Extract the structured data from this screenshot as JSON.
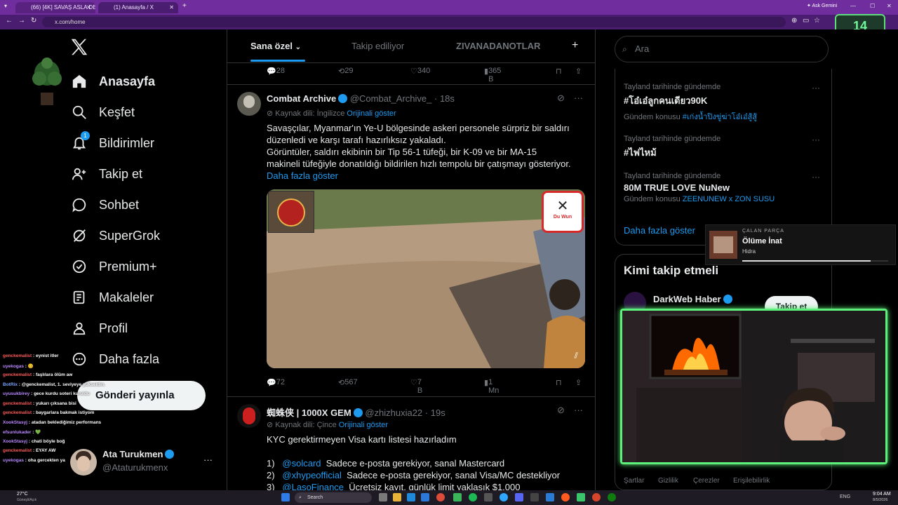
{
  "browser": {
    "tabs": [
      "(66) [4K] SAVAŞ ASLA DEĞİŞMEZ",
      "(1) Anasayfa / X"
    ],
    "url": "x.com/home",
    "ask_gemini": "Ask Gemini"
  },
  "overlay": {
    "timer": "14",
    "now_playing_label": "ÇALAN PARÇA",
    "now_playing_title": "Ölüme İnat",
    "now_playing_artist": "Hidra",
    "now_playing_progress": 0.88
  },
  "nav": {
    "items": [
      "Anasayfa",
      "Keşfet",
      "Bildirimler",
      "Takip et",
      "Sohbet",
      "SuperGrok",
      "Premium+",
      "Makaleler",
      "Profil",
      "Daha fazla"
    ],
    "notif_badge": "1",
    "post_button": "Gönderi yayınla",
    "account_name": "Ata Turukmen",
    "account_handle": "@Ataturukmenx",
    "account_more": "···"
  },
  "chat": [
    {
      "user": "genckemalist",
      "msg": "eynist itler",
      "color": "#ff5a5a"
    },
    {
      "user": "uyekogas",
      "msg": "😊",
      "color": "#bb88ff"
    },
    {
      "user": "genckemalist",
      "msg": "faşlılara ölüm aw",
      "color": "#ff5a5a"
    },
    {
      "user": "BotRix",
      "msg": "@genckemalist, 1. seviyeye yükseldin.",
      "color": "#7aa6ff"
    },
    {
      "user": "uyusukbirey",
      "msg": "gece kurdu soteri kuruldu",
      "color": "#bb88ff"
    },
    {
      "user": "genckemalist",
      "msg": "yukarı çıksana bisi",
      "color": "#ff5a5a"
    },
    {
      "user": "genckemalist",
      "msg": "baygarlara bakmak istiyom",
      "color": "#ff5a5a"
    },
    {
      "user": "XookStasyj",
      "msg": "atadan beklediğimiz performans",
      "color": "#bb88ff"
    },
    {
      "user": "efsunlukader",
      "msg": "💚",
      "color": "#bb88ff"
    },
    {
      "user": "XookStasyj",
      "msg": "chati böyle boğ",
      "color": "#bb88ff"
    },
    {
      "user": "genckemalist",
      "msg": "EYAY AW",
      "color": "#ff5a5a"
    },
    {
      "user": "uyekogas",
      "msg": "oha gercekten ya",
      "color": "#bb88ff"
    }
  ],
  "feed": {
    "tabs": [
      "Sana özel",
      "Takip ediliyor",
      "ZIVANADANOTLAR"
    ],
    "add_tab": "+",
    "prev_actions": {
      "replies": "28",
      "reposts": "29",
      "likes": "340",
      "views": "365 B"
    },
    "tweet1": {
      "name": "Combat Archive",
      "handle": "@Combat_Archive_",
      "time": "· 18s",
      "source_lang": "Kaynak dili: İngilizce",
      "show_original": "Orijinali göster",
      "line1": "Savaşçılar, Myanmar'ın Ye-U bölgesinde askeri personele sürpriz bir saldırı",
      "line2": "düzenledi ve karşı tarafı hazırlıksız yakaladı.",
      "line3": "Görüntüler, saldırı ekibinin bir Tip 56-1 tüfeği, bir K-09 ve bir MA-15",
      "line4": "makineli tüfeğiyle donatıldığı bildirilen hızlı tempolu bir çatışmayı gösteriyor.",
      "show_more": "Daha fazla göster",
      "video_badge": "Du Wun",
      "actions": {
        "replies": "72",
        "reposts": "567",
        "likes": "7 B",
        "views": "1 Mn"
      }
    },
    "tweet2": {
      "name": "蜘蛛侠 | 1000X GEM",
      "handle": "@zhizhuxia22",
      "time": "· 19s",
      "source_lang": "Kaynak dili: Çince",
      "show_original": "Orijinali göster",
      "line1": "KYC gerektirmeyen Visa kartı listesi hazırladım",
      "items": [
        {
          "n": "1)",
          "link": "@solcard",
          "text": "Sadece e-posta gerekiyor, sanal Mastercard"
        },
        {
          "n": "2)",
          "link": "@xhypeofficial",
          "text": "Sadece e-posta gerekiyor, sanal Visa/MC destekliyor"
        },
        {
          "n": "3)",
          "link": "@LasoFinance",
          "text": "Ücretsiz kayıt, günlük limit yaklaşık $1.000"
        }
      ]
    }
  },
  "right": {
    "search_placeholder": "Ara",
    "trends": [
      {
        "cat": "Tayland tarihinde gündemde",
        "title": "#โอ๋เอ๋ลูกคนเดียว90K",
        "desc_pre": "Gündem konusu",
        "desc_link": "#เก่งน้ำปิงขู่ฆ่าโอ๋เอ๋สู้สู้"
      },
      {
        "cat": "Tayland tarihinde gündemde",
        "title": "#ไฟไหม้",
        "desc_pre": "",
        "desc_link": ""
      },
      {
        "cat": "Tayland tarihinde gündemde",
        "title": "80M TRUE LOVE NuNew",
        "desc_pre": "Gündem konusu",
        "desc_link": "ZEENUNEW x ZON SUSU"
      }
    ],
    "show_more": "Daha fazla göster",
    "who_to_follow": "Kimi takip etmeli",
    "suggest_name": "DarkWeb Haber",
    "follow_btn": "Takip et",
    "footer": [
      "Şartlar",
      "Gizlilik",
      "Çerezler",
      "Erişilebilirlik"
    ]
  },
  "taskbar": {
    "weather": "27°C",
    "weather_desc": "Güneşli/Açık",
    "search": "Search",
    "lang": "ENG",
    "time": "9:04 AM",
    "date": "8/5/2026"
  }
}
